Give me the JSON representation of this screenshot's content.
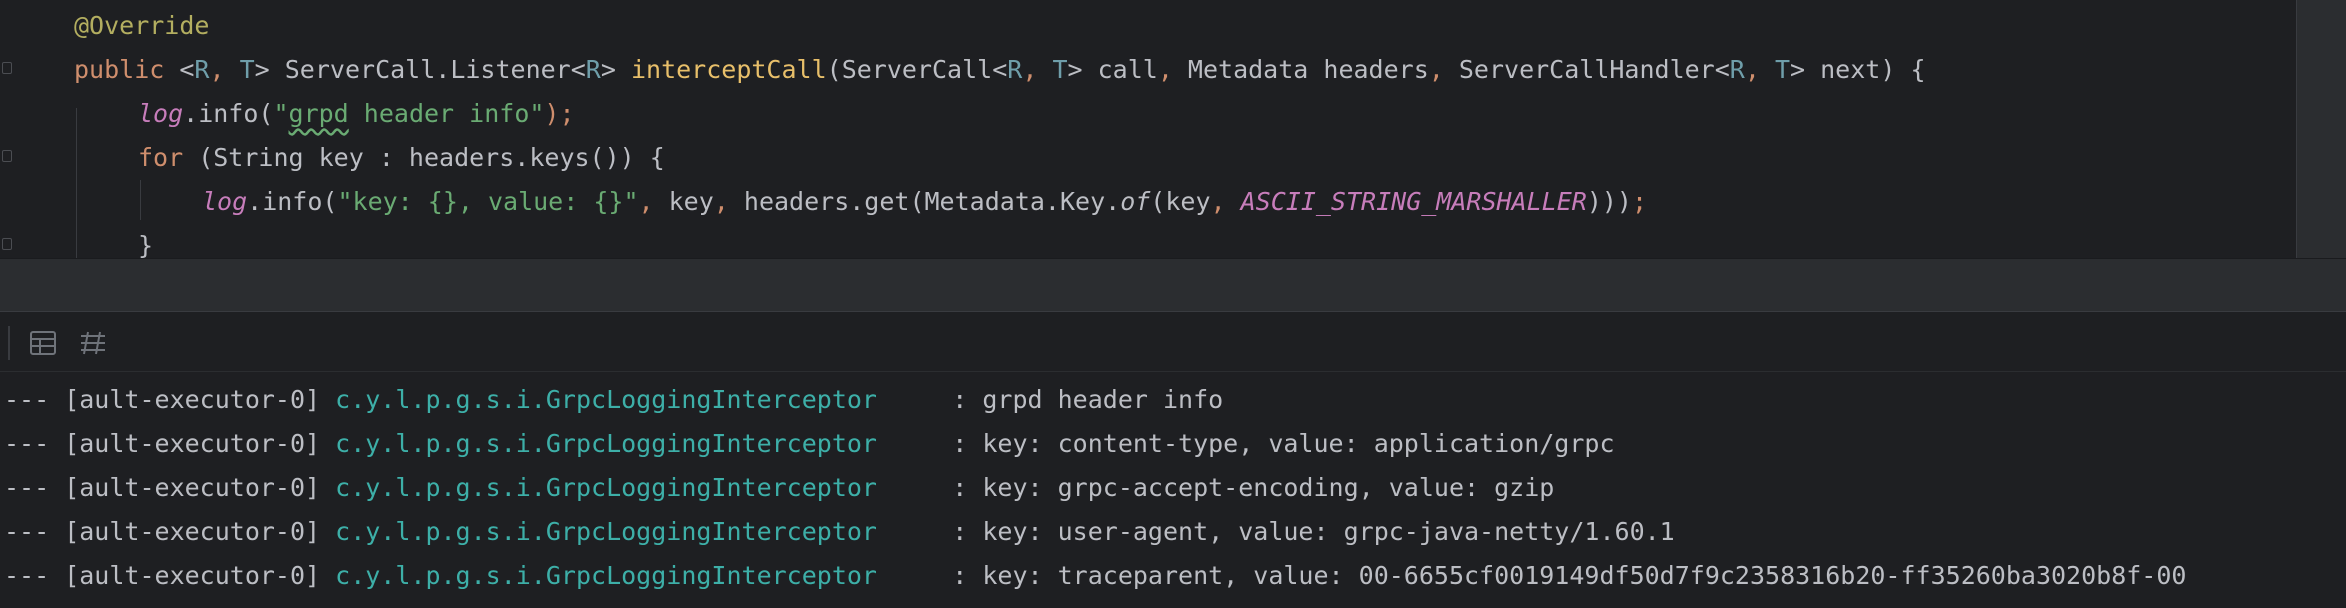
{
  "editor": {
    "line1": {
      "annotation": "@Override"
    },
    "line2": {
      "kw_public": "public",
      "lt1": " <",
      "tp_R1": "R",
      "comma1": ", ",
      "tp_T1": "T",
      "gt1": "> ServerCall.Listener<",
      "tp_R2": "R",
      "gt2": "> ",
      "method": "interceptCall",
      "params_a": "(ServerCall<",
      "tp_R3": "R",
      "comma2": ", ",
      "tp_T2": "T",
      "params_b": "> call",
      "comma3": ",",
      "params_c": " Metadata headers",
      "comma4": ",",
      "params_d": " ServerCallHandler<",
      "tp_R4": "R",
      "comma5": ", ",
      "tp_T3": "T",
      "params_e": "> next) {"
    },
    "line3": {
      "log": "log",
      "call": ".info(",
      "str_q1": "\"",
      "str_typo": "grpd",
      "str_rest": " header info\"",
      "end": ");"
    },
    "line4": {
      "kw_for": "for",
      "rest": " (String key : headers.keys()) {"
    },
    "line5": {
      "log": "log",
      "call": ".info(",
      "str": "\"key: {}, value: {}\"",
      "comma1": ",",
      "a": " key",
      "comma2": ",",
      "b": " headers.get(Metadata.Key.",
      "of": "of",
      "c": "(key",
      "comma3": ", ",
      "marshaller": "ASCII_STRING_MARSHALLER",
      "d": ")))",
      "semi": ";"
    },
    "line6": {
      "brace": "}"
    }
  },
  "toolbar": {
    "icons": [
      "table-icon",
      "filter-settings-icon"
    ]
  },
  "console": {
    "lines": [
      {
        "prefix": "--- [ault-executor-0] ",
        "logger": "c.y.l.p.g.s.i.GrpcLoggingInterceptor",
        "message": "     : grpd header info"
      },
      {
        "prefix": "--- [ault-executor-0] ",
        "logger": "c.y.l.p.g.s.i.GrpcLoggingInterceptor",
        "message": "     : key: content-type, value: application/grpc"
      },
      {
        "prefix": "--- [ault-executor-0] ",
        "logger": "c.y.l.p.g.s.i.GrpcLoggingInterceptor",
        "message": "     : key: grpc-accept-encoding, value: gzip"
      },
      {
        "prefix": "--- [ault-executor-0] ",
        "logger": "c.y.l.p.g.s.i.GrpcLoggingInterceptor",
        "message": "     : key: user-agent, value: grpc-java-netty/1.60.1"
      },
      {
        "prefix": "--- [ault-executor-0] ",
        "logger": "c.y.l.p.g.s.i.GrpcLoggingInterceptor",
        "message": "     : key: traceparent, value: 00-6655cf0019149df50d7f9c2358316b20-ff35260ba3020b8f-00"
      }
    ]
  },
  "colors": {
    "background": "#1e1f22",
    "panel": "#2b2d30",
    "keyword": "#cf8e6d",
    "annotation": "#b3ae60",
    "method": "#e8bf6a",
    "string": "#6aab73",
    "static_field": "#c77dbb",
    "logger": "#3dafa8"
  }
}
